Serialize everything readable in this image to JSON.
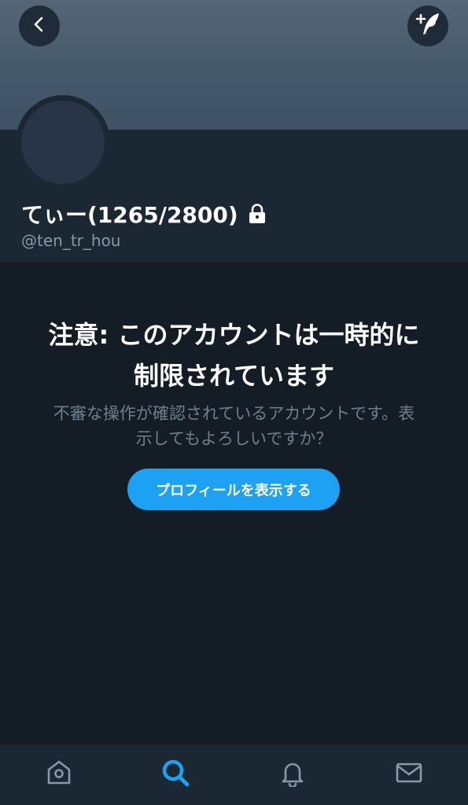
{
  "profile": {
    "display_name": "てぃー(1265/2800)",
    "handle": "@ten_tr_hou",
    "protected": true
  },
  "warning": {
    "title_line1": "注意: このアカウントは一時的に",
    "title_line2": "制限されています",
    "body_line1": "不審な操作が確認されているアカウントです。表",
    "body_line2": "示してもよろしいですか？",
    "button_label": "プロフィールを表示する"
  },
  "header": {
    "back_icon": "chevron-left-icon",
    "compose_icon": "compose-tweet-icon"
  },
  "tab_bar": {
    "tabs": [
      {
        "name": "home",
        "icon": "home-icon",
        "active": false
      },
      {
        "name": "search",
        "icon": "search-icon",
        "active": true
      },
      {
        "name": "notifications",
        "icon": "bell-icon",
        "active": false
      },
      {
        "name": "messages",
        "icon": "mail-icon",
        "active": false
      }
    ]
  },
  "colors": {
    "background": "#141d26",
    "profile_band": "#1c2734",
    "accent": "#1da1f2",
    "muted_text": "#8899a6",
    "inactive_icon": "#8899a6"
  }
}
